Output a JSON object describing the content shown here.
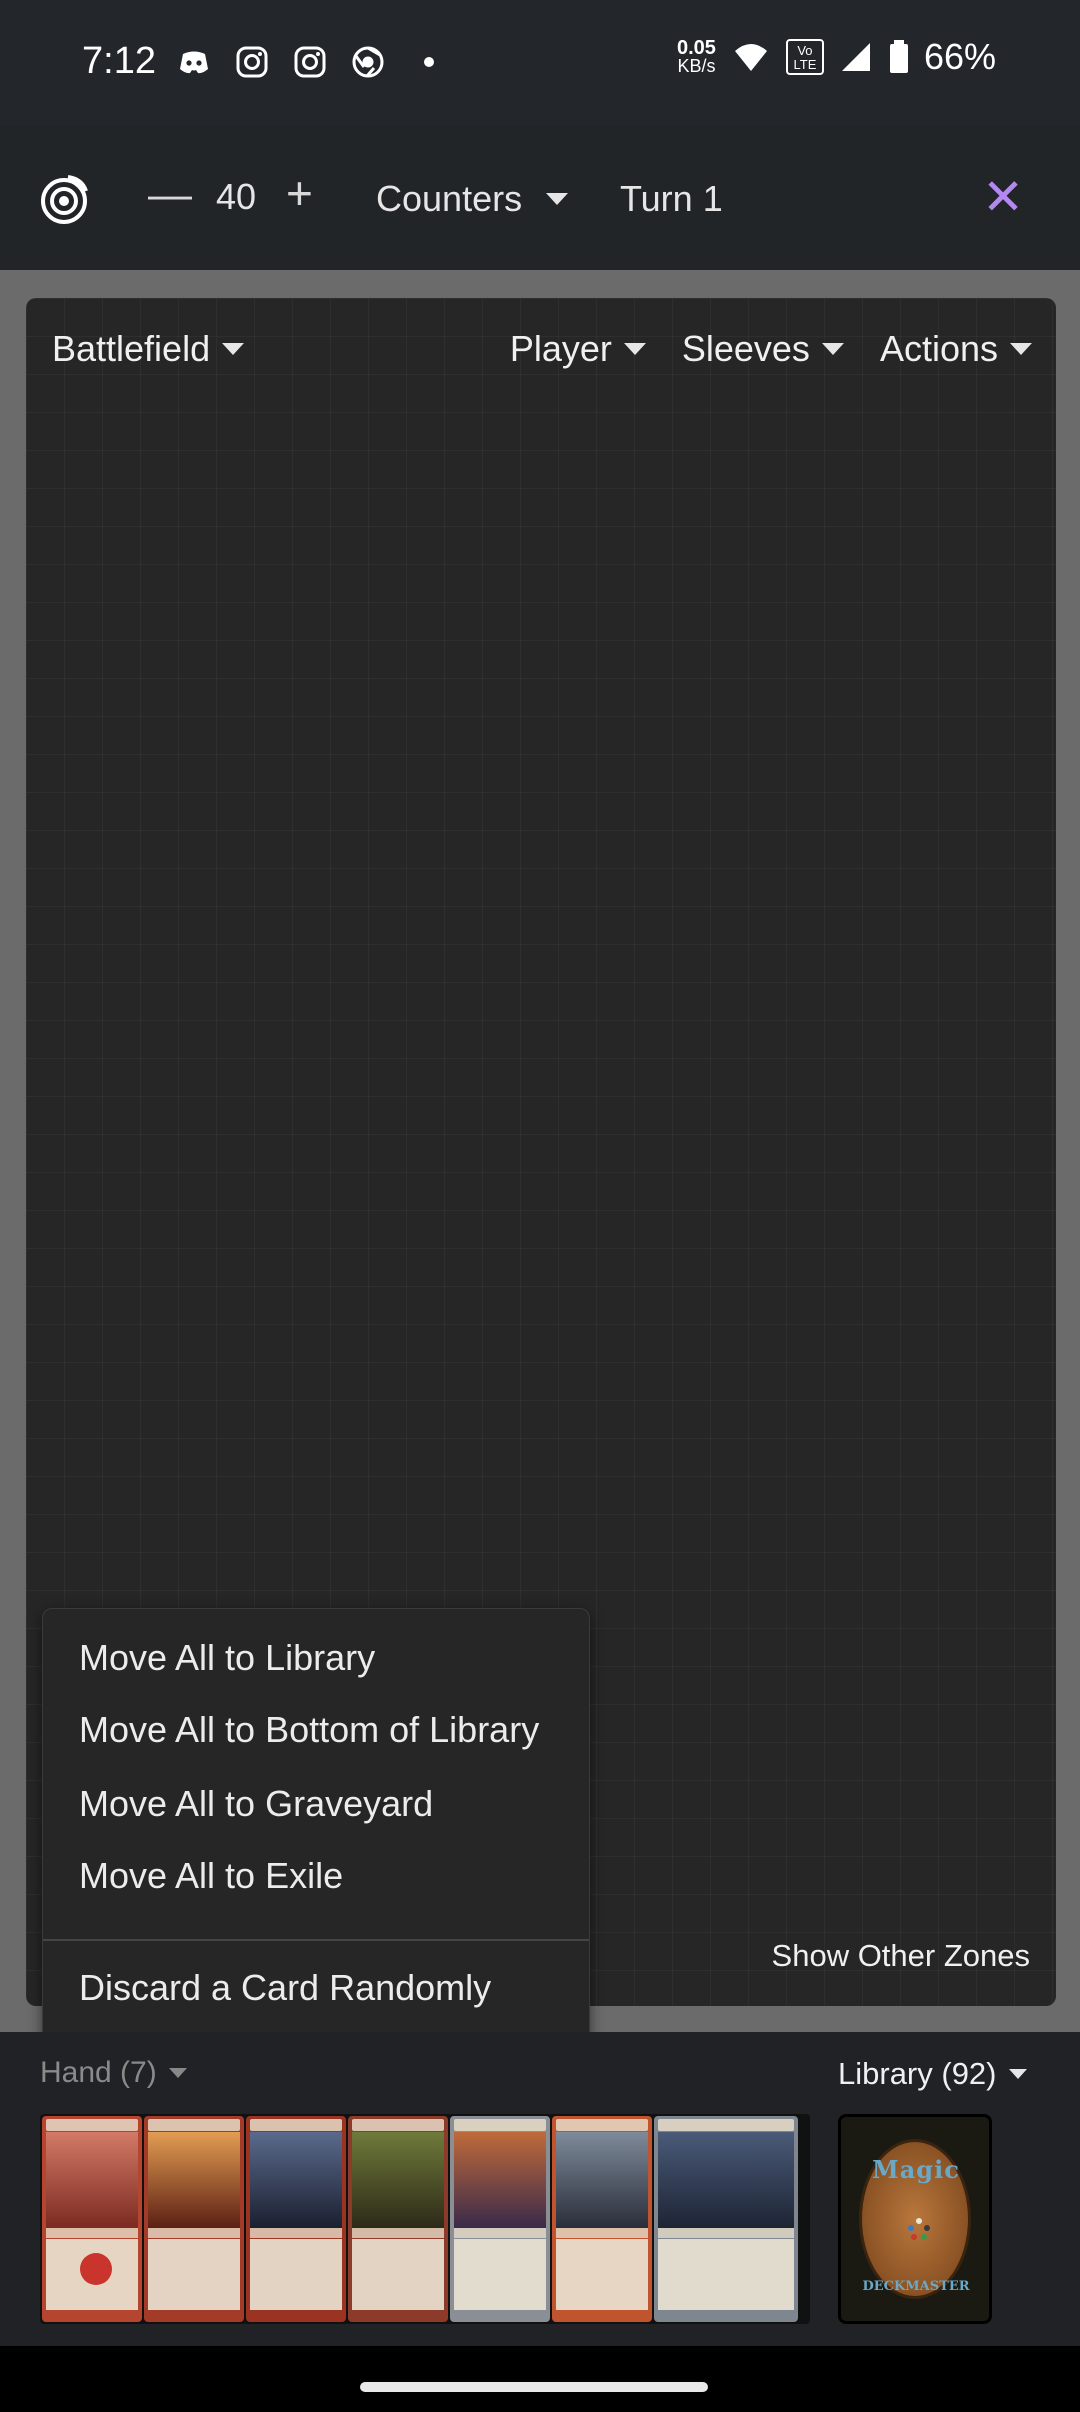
{
  "status_bar": {
    "time": "7:12",
    "net_speed": "0.05",
    "net_unit": "KB/s",
    "volte": "Vo LTE",
    "battery": "66%",
    "icons": [
      "discord-icon",
      "instagram-icon",
      "instagram-icon",
      "chrome-icon",
      "dot-icon",
      "wifi-icon",
      "signal-icon",
      "battery-icon"
    ]
  },
  "header": {
    "life_minus": "—",
    "life_total": "40",
    "life_plus": "+",
    "counters_label": "Counters",
    "turn_label": "Turn 1",
    "close_symbol": "✕",
    "accent_color": "#b388f0"
  },
  "battlefield": {
    "zone_label": "Battlefield",
    "menus": [
      "Player",
      "Sleeves",
      "Actions"
    ],
    "show_other_zones": "Show Other Zones"
  },
  "dropdown": {
    "items": [
      "Move All to Library",
      "Move All to Bottom of Library",
      "Move All to Graveyard",
      "Move All to Exile",
      "Discard a Card Randomly"
    ]
  },
  "hand": {
    "label": "Hand (7)",
    "card_count": 7
  },
  "library": {
    "label": "Library (92)",
    "card_back_title": "Magic",
    "card_back_footer": "DECKMASTER"
  }
}
